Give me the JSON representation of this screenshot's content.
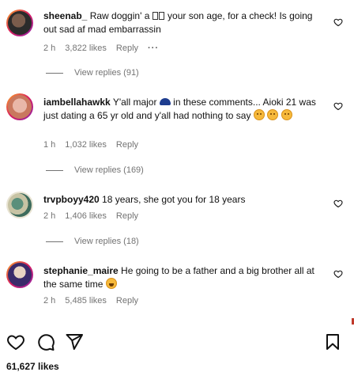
{
  "comments": [
    {
      "username": "sheenab_",
      "text_before_glyphs": " Raw doggin' a ",
      "text_after_glyphs": " your son age, for a check! Is going out sad af mad embarrassin",
      "time": "2 h",
      "likes": "3,822 likes",
      "reply_label": "Reply",
      "more_label": "···",
      "view_replies": "View replies (91)",
      "avatar_colors": [
        "#2b2b2b",
        "#7a5c4c"
      ]
    },
    {
      "username": "iambellahawkk",
      "text_part1": " Y'all major ",
      "text_part2": " in these comments... Aioki 21 was just dating a 65 yr old and y'all had nothing to say ",
      "time": "1 h",
      "likes": "1,032 likes",
      "reply_label": "Reply",
      "view_replies": "View replies (169)",
      "avatar_colors": [
        "#e9b7a8",
        "#c9785e"
      ]
    },
    {
      "username": "trvpboyy420",
      "text": " 18 years, she got you for 18 years",
      "time": "2 h",
      "likes": "1,406 likes",
      "reply_label": "Reply",
      "view_replies": "View replies (18)",
      "avatar_colors": [
        "#5a8f7b",
        "#c7c3a4"
      ]
    },
    {
      "username": "stephanie_maire",
      "text": " He going to be a father and a big brother all at the same time ",
      "time": "2 h",
      "likes": "5,485 likes",
      "reply_label": "Reply",
      "avatar_colors": [
        "#3a2a6a",
        "#e8d3c2"
      ]
    }
  ],
  "footer": {
    "likes": "61,627 likes",
    "icons": [
      "heart-icon",
      "comment-icon",
      "share-icon",
      "bookmark-icon"
    ]
  },
  "colors": {
    "meta": "#737373",
    "text": "#111111"
  }
}
